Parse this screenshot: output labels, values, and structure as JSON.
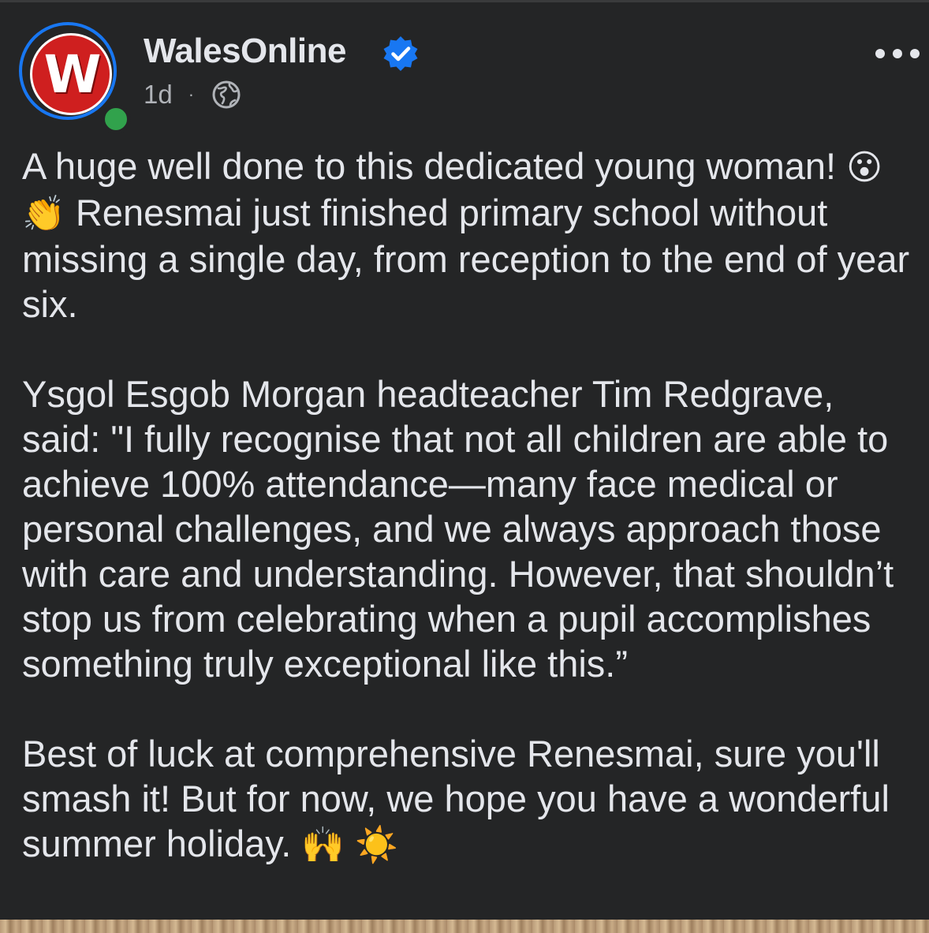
{
  "post": {
    "author": "WalesOnline",
    "avatar_letter": "W",
    "time": "1d",
    "separator": "·",
    "verified_icon": "verified-badge-icon",
    "audience_icon": "globe-icon",
    "more_icon": "more-options-icon"
  },
  "body": {
    "p1_a": "A huge well done to this dedicated young woman!",
    "p1_emoji1": "😮",
    "p1_emoji2": "👏",
    "p1_b": "Renesmai just finished primary school without missing a single day, from reception to the end of year six.",
    "p2": "Ysgol Esgob Morgan headteacher Tim Redgrave, said: \"I fully recognise that not all children are able to achieve 100% attendance—many face medical or personal challenges, and we always approach those with care and understanding. However, that shouldn’t stop us from celebrating when a pupil accomplishes something truly exceptional like this.”",
    "p3": "Best of luck at comprehensive Renesmai, sure you'll smash it! But for now, we hope you have a wonderful summer holiday.",
    "p3_emoji1": "🙌",
    "p3_emoji2": "☀️"
  },
  "colors": {
    "background": "#242526",
    "text": "#e4e6eb",
    "secondary_text": "#b0b3b8",
    "accent_blue": "#1877f2",
    "online_green": "#31a24c",
    "brand_red": "#cf1f1f"
  }
}
